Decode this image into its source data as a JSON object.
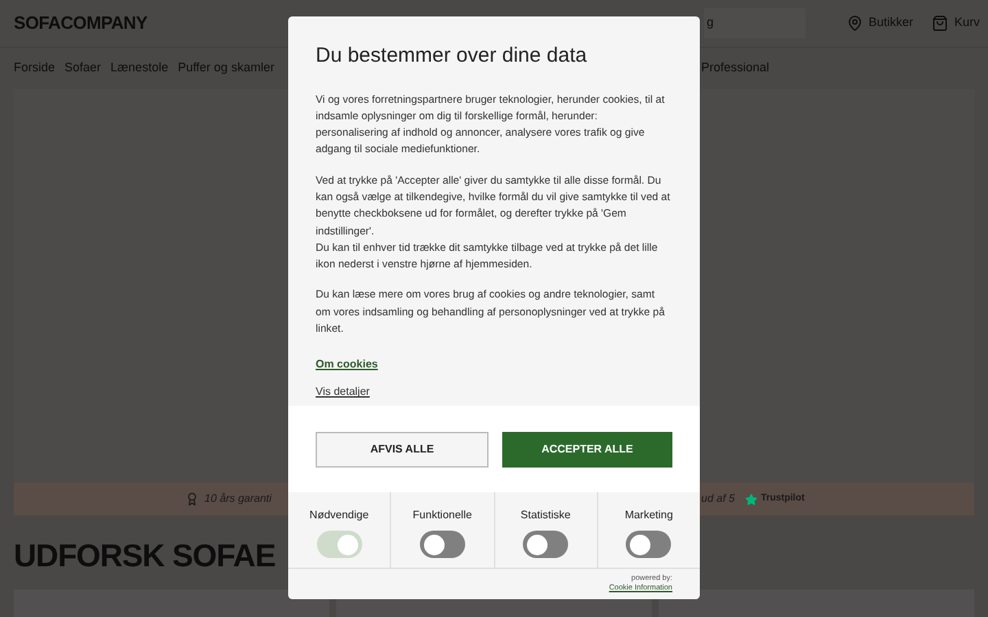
{
  "header": {
    "logo": "SOFACOMPANY",
    "search": {
      "value": "g"
    },
    "links": [
      {
        "kind": "pin",
        "label": "Butikker"
      },
      {
        "kind": "bag",
        "label": "Kurv"
      }
    ]
  },
  "nav": {
    "left": [
      "Forside",
      "Sofaer",
      "Lænestole",
      "Puffer og skamler"
    ],
    "right": [
      "Professional"
    ]
  },
  "banner": {
    "left": "10 års garanti",
    "right": "ud af 5",
    "rating_brand": "Trustpilot"
  },
  "heading": "UDFORSK SOFAE",
  "consent": {
    "title": "Du bestemmer over dine data",
    "paragraphs": [
      "Vi og vores forretningspartnere bruger teknologier, herunder cookies, til at indsamle oplysninger om dig til forskellige formål, herunder: personalisering af indhold og annoncer, analysere vores trafik og give adgang til sociale mediefunktioner.",
      "Ved at trykke på 'Accepter alle' giver du samtykke til alle disse formål. Du kan også vælge at tilkendegive, hvilke formål du vil give samtykke til ved at benytte checkboksene ud for formålet, og derefter trykke på 'Gem indstillinger'.\nDu kan til enhver tid trække dit samtykke tilbage ved at trykke på det lille ikon nederst i venstre hjørne af hjemmesiden.",
      "Du kan læse mere om vores brug af cookies og andre teknologier, samt om vores indsamling og behandling af personoplysninger ved at trykke på linket."
    ],
    "links": [
      "Om cookies",
      "Vis detaljer"
    ],
    "buttons": [
      {
        "kind": "secondary",
        "label": "AFVIS ALLE"
      },
      {
        "kind": "primary",
        "label": "ACCEPTER ALLE"
      }
    ],
    "toggles": [
      {
        "label": "Nødvendige",
        "on": true,
        "disabled": true
      },
      {
        "label": "Funktionelle",
        "on": false,
        "disabled": false
      },
      {
        "label": "Statistiske",
        "on": false,
        "disabled": false
      },
      {
        "label": "Marketing",
        "on": false,
        "disabled": false
      }
    ],
    "powered_by": "powered by:",
    "powered_link": "Cookie Information"
  }
}
